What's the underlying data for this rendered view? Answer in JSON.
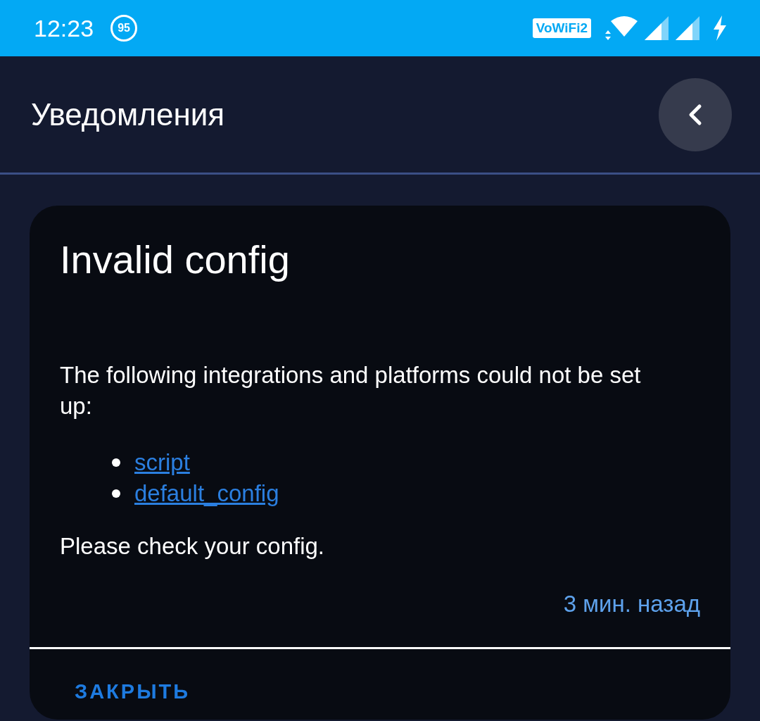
{
  "status_bar": {
    "time": "12:23",
    "notification_badge": "95",
    "wifi_calling": "VoWiFi2"
  },
  "header": {
    "title": "Уведомления"
  },
  "notification": {
    "title": "Invalid config",
    "message": "The following integrations and platforms could not be set up:",
    "links": [
      "script",
      "default_config"
    ],
    "footer_message": "Please check your config.",
    "time": "3 мин. назад",
    "action": "ЗАКРЫТЬ"
  }
}
